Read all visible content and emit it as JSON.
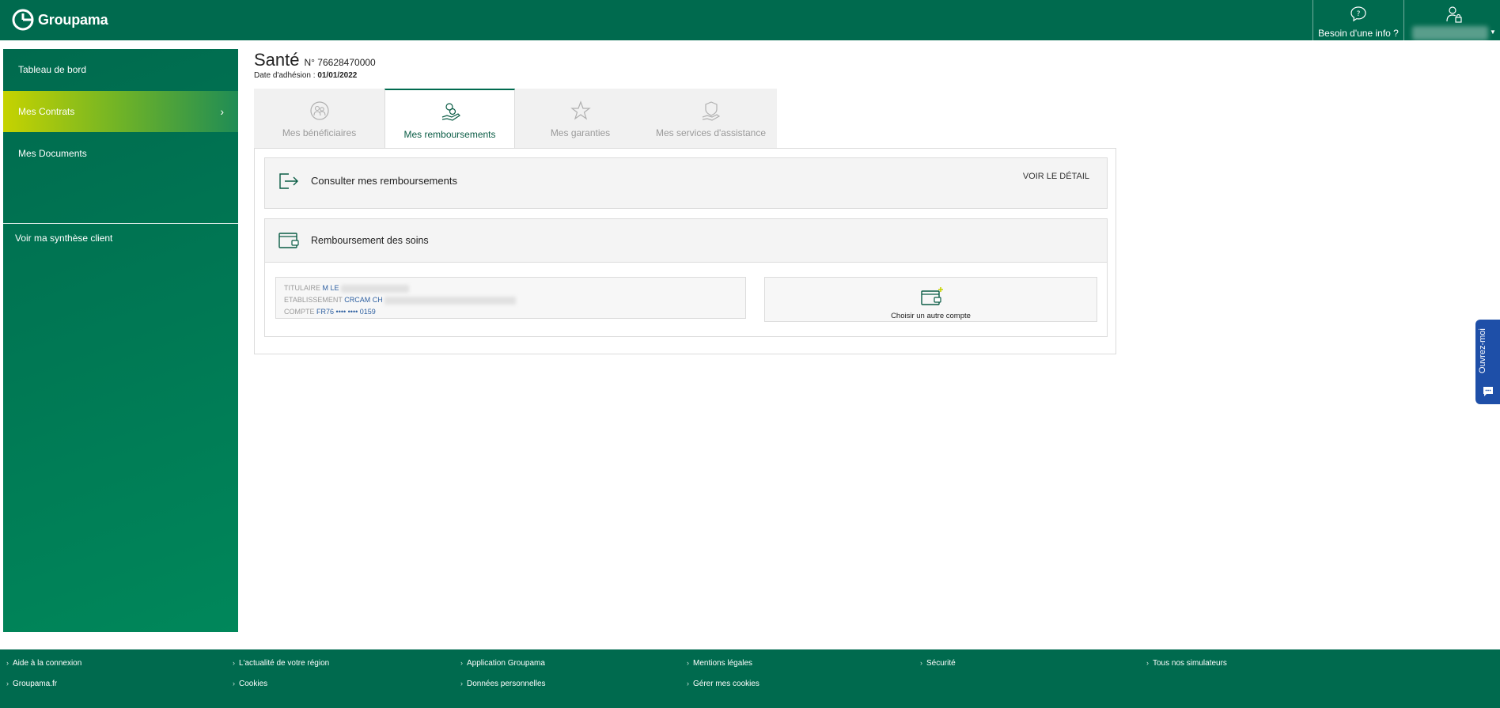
{
  "header": {
    "brand": "Groupama",
    "help_label": "Besoin d'une info ?"
  },
  "sidebar": {
    "items": [
      {
        "label": "Tableau de bord"
      },
      {
        "label": "Mes Contrats"
      },
      {
        "label": "Mes Documents"
      }
    ],
    "synthese_link": "Voir ma synthèse client"
  },
  "contract": {
    "title": "Santé",
    "number": "N° 76628470000",
    "adhesion_label": "Date d'adhésion : ",
    "adhesion_date": "01/01/2022"
  },
  "tabs": [
    {
      "label": "Mes bénéficiaires",
      "icon": "users-icon"
    },
    {
      "label": "Mes remboursements",
      "icon": "coins-hand-icon"
    },
    {
      "label": "Mes garanties",
      "icon": "star-icon"
    },
    {
      "label": "Mes services d'assistance",
      "icon": "shield-hand-icon"
    }
  ],
  "consult": {
    "title": "Consulter mes remboursements",
    "link": "VOIR LE DÉTAIL"
  },
  "soins": {
    "title": "Remboursement des soins",
    "account": {
      "titulaire_label": "TITULAIRE",
      "titulaire_value": "M LE",
      "etab_label": "ETABLISSEMENT",
      "etab_value": "CRCAM CH",
      "compte_label": "COMPTE",
      "compte_value": "FR76 •••• •••• 0159"
    },
    "choose_label": "Choisir un autre compte"
  },
  "chat": {
    "label": "Ouvrez-moi"
  },
  "footer": {
    "links": [
      "Aide à la connexion",
      "L'actualité de votre région",
      "Application Groupama",
      "Mentions légales",
      "Sécurité",
      "Tous nos simulateurs",
      "Groupama.fr",
      "Cookies",
      "Données personnelles",
      "Gérer mes cookies"
    ]
  },
  "colors": {
    "brand_green": "#006a4e",
    "active_tab_green": "#0a5c45",
    "lime": "#c6d300",
    "chat_blue": "#1e4fa8"
  }
}
